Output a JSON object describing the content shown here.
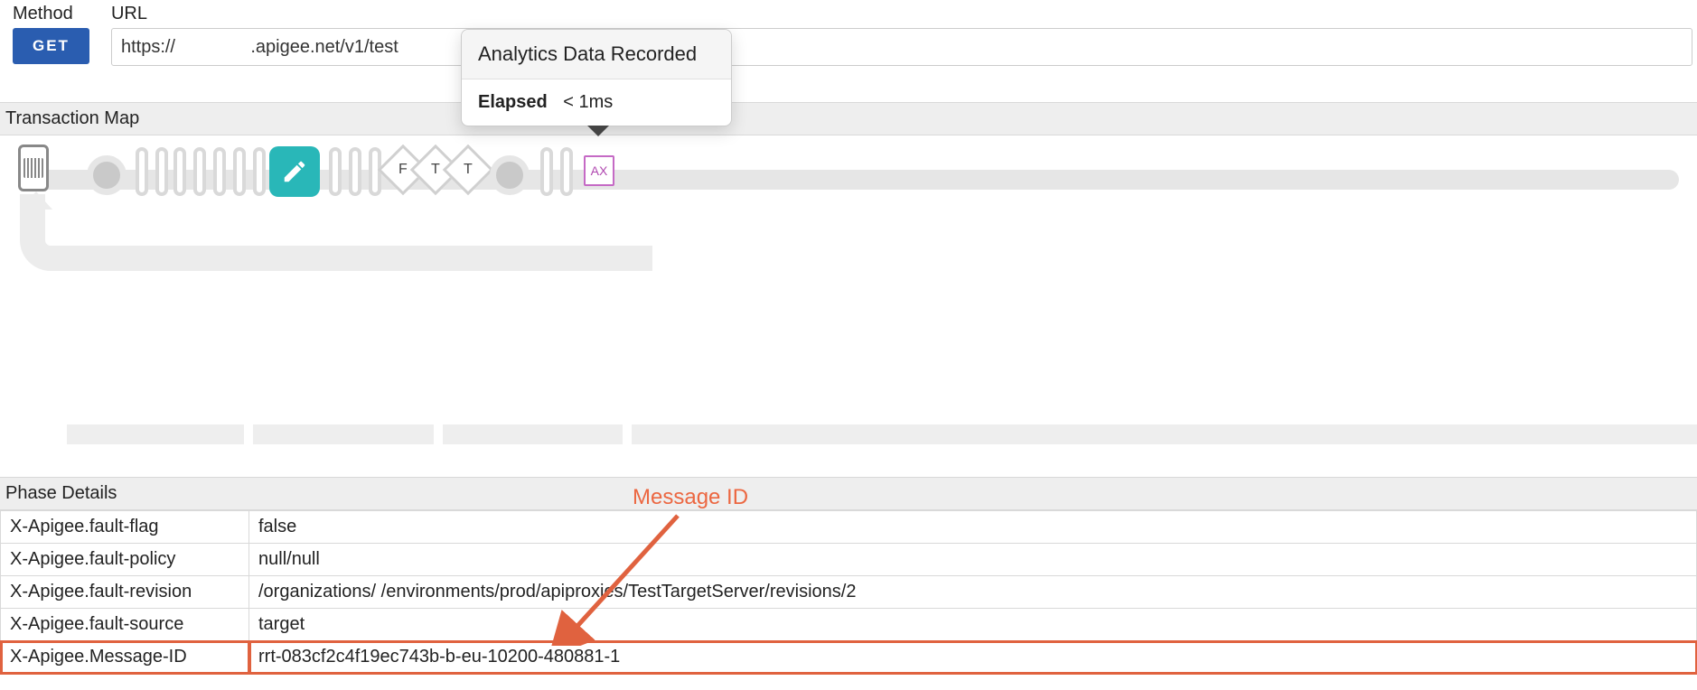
{
  "request": {
    "method_label": "Method",
    "url_label": "URL",
    "method_button": "GET",
    "url_value": "https://               .apigee.net/v1/test"
  },
  "transaction_map": {
    "header": "Transaction Map",
    "diamonds": [
      "F",
      "T",
      "T"
    ],
    "ax_label": "AX"
  },
  "popover": {
    "title": "Analytics Data Recorded",
    "elapsed_label": "Elapsed",
    "elapsed_value": "< 1ms"
  },
  "phase_details": {
    "header": "Phase Details",
    "rows": [
      {
        "k": "X-Apigee.fault-flag",
        "v": "false"
      },
      {
        "k": "X-Apigee.fault-policy",
        "v": "null/null"
      },
      {
        "k": "X-Apigee.fault-revision",
        "v": "/organizations/          /environments/prod/apiproxies/TestTargetServer/revisions/2"
      },
      {
        "k": "X-Apigee.fault-source",
        "v": "target"
      },
      {
        "k": "X-Apigee.Message-ID",
        "v": "rrt-083cf2c4f19ec743b-b-eu-10200-480881-1"
      }
    ]
  },
  "annotation": {
    "label": "Message ID"
  }
}
